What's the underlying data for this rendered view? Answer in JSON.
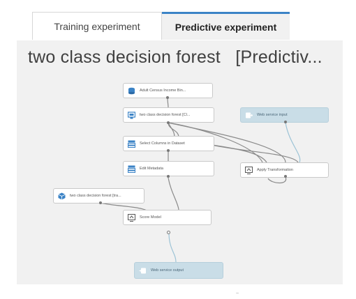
{
  "tabs": [
    {
      "label": "Training experiment"
    },
    {
      "label": "Predictive experiment"
    }
  ],
  "experiment": {
    "title": "two class decision forest   [Predictiv..."
  },
  "nodes": {
    "adult_census": {
      "label": "Adult Census Income Bin..."
    },
    "decision_forest_top": {
      "label": "two class decision forest [Cl..."
    },
    "web_service_input": {
      "label": "Web service input"
    },
    "select_columns": {
      "label": "Select Columns in Dataset"
    },
    "edit_metadata": {
      "label": "Edit Metadata"
    },
    "apply_transformation": {
      "label": "Apply Transformation"
    },
    "decision_forest_left": {
      "label": "two class decision forest [tra..."
    },
    "score_model": {
      "label": "Score Model"
    },
    "web_service_output": {
      "label": "Web service output"
    }
  },
  "colors": {
    "tab_accent": "#3b83c6",
    "canvas_bg": "#f1f1f1",
    "web_service_node": "#c9dde7",
    "edge": "#8a8a8a",
    "web_service_edge": "#9cc3d6"
  },
  "footer_mark": "~"
}
